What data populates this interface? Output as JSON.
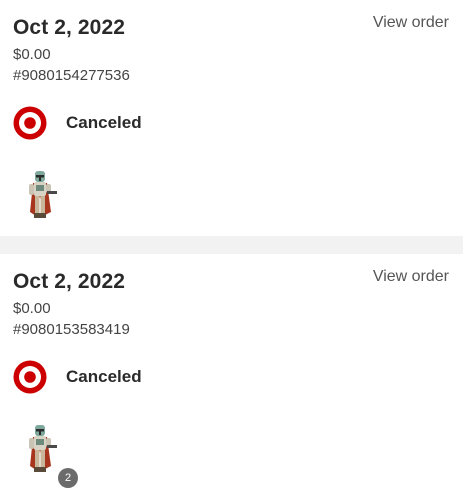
{
  "orders": [
    {
      "date": "Oct 2, 2022",
      "view_order_label": "View order",
      "total": "$0.00",
      "order_number": "#9080154277536",
      "status": "Canceled",
      "store_logo_icon": "target-bullseye-icon",
      "item_icon": "action-figure-thumbnail",
      "quantity_badge": null
    },
    {
      "date": "Oct 2, 2022",
      "view_order_label": "View order",
      "total": "$0.00",
      "order_number": "#9080153583419",
      "status": "Canceled",
      "store_logo_icon": "target-bullseye-icon",
      "item_icon": "action-figure-thumbnail",
      "quantity_badge": "2"
    }
  ],
  "colors": {
    "brand_red": "#cc0000",
    "badge_gray": "#6b6b6b",
    "divider_gray": "#f2f2f2"
  }
}
